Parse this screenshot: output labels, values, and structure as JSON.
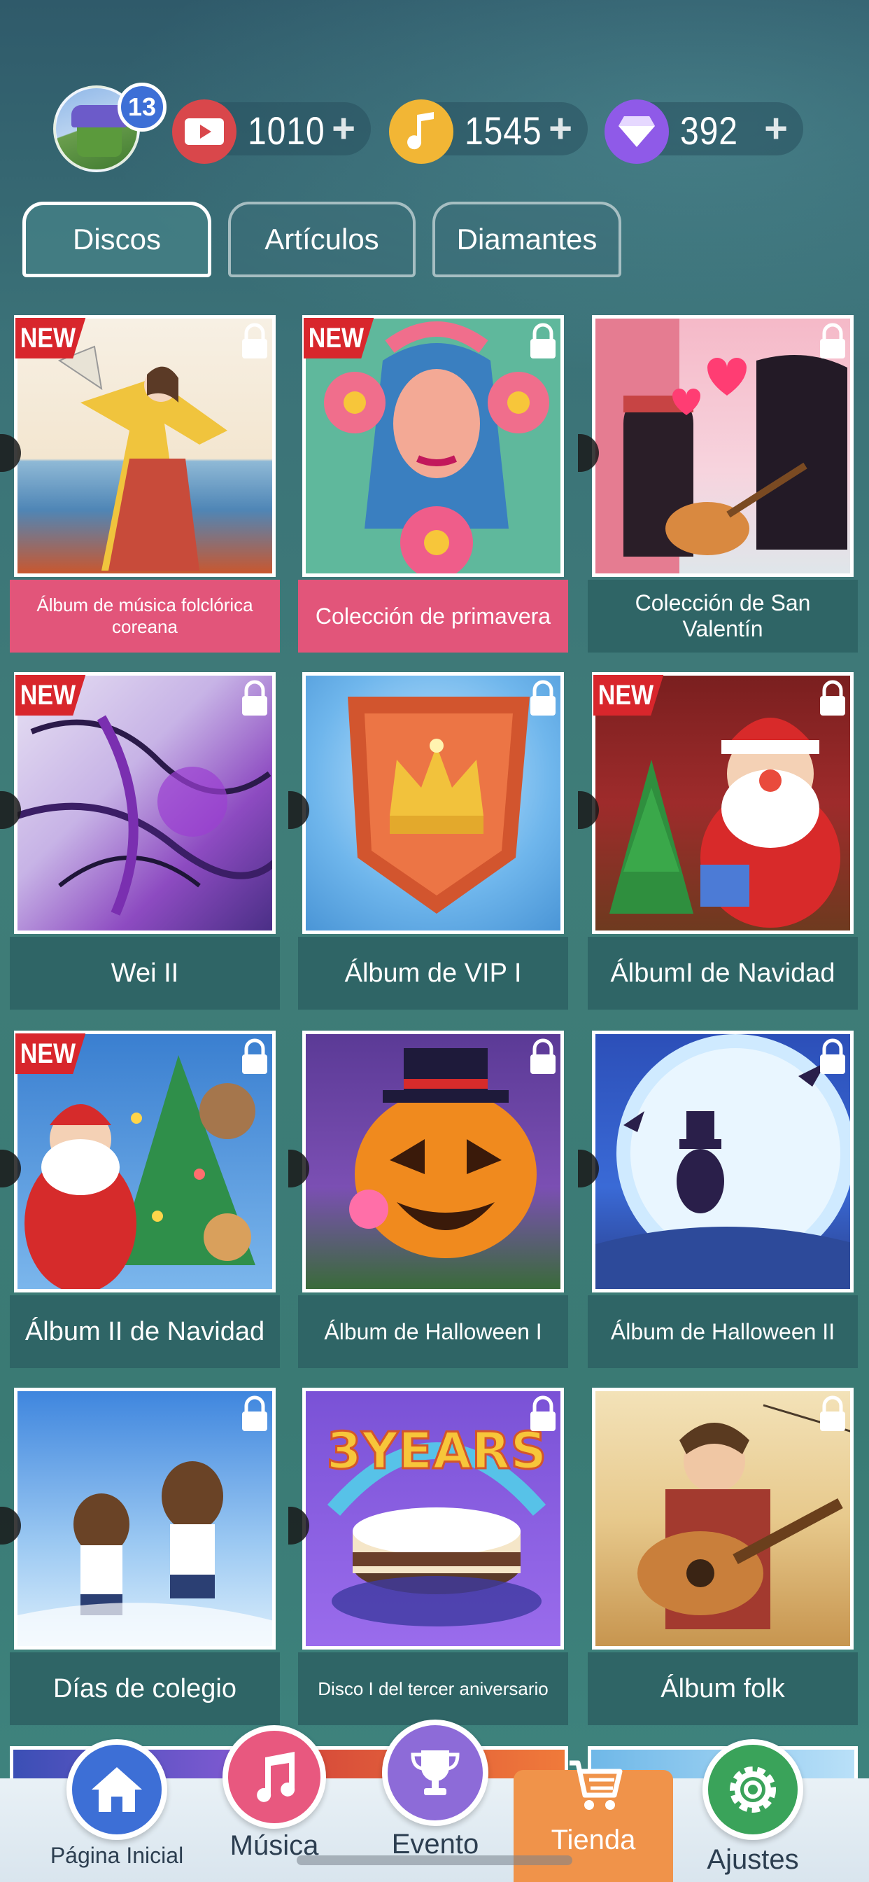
{
  "header": {
    "notification_count": "13",
    "tickets": "1010",
    "notes": "1545",
    "diamonds": "392",
    "plus": "+"
  },
  "tabs": [
    {
      "label": "Discos",
      "active": true
    },
    {
      "label": "Artículos",
      "active": false
    },
    {
      "label": "Diamantes",
      "active": false
    }
  ],
  "new_badge": "NEW",
  "albums": [
    {
      "title": "Álbum de música folclórica coreana",
      "new": true,
      "locked": true
    },
    {
      "title": "Colección de primavera",
      "new": true,
      "locked": true
    },
    {
      "title": "Colección de San Valentín",
      "new": false,
      "locked": true
    },
    {
      "title": "Wei II",
      "new": true,
      "locked": true
    },
    {
      "title": "Álbum de VIP I",
      "new": false,
      "locked": true
    },
    {
      "title": "ÁlbumI de Navidad",
      "new": true,
      "locked": true
    },
    {
      "title": "Álbum II de Navidad",
      "new": true,
      "locked": true
    },
    {
      "title": "Álbum de Halloween I",
      "new": false,
      "locked": true
    },
    {
      "title": "Álbum de Halloween II",
      "new": false,
      "locked": true
    },
    {
      "title": "Días de colegio",
      "new": false,
      "locked": true
    },
    {
      "title": "Disco I del tercer aniversario",
      "new": false,
      "locked": true
    },
    {
      "title": "Álbum folk",
      "new": false,
      "locked": true
    }
  ],
  "cover_art": {
    "anniversary_text": "3YEARS"
  },
  "nav": {
    "home": "Página Inicial",
    "music": "Música",
    "event": "Evento",
    "shop": "Tienda",
    "settings": "Ajustes"
  },
  "colors": {
    "tickets": "#d9474b",
    "notes": "#f2b635",
    "diamonds": "#8f5ae8",
    "home": "#3d6fd6",
    "music": "#e8587f",
    "event": "#8d6bd8",
    "shop": "#f0934a",
    "settings": "#3aa35a",
    "label_pink": "#e2557a"
  }
}
